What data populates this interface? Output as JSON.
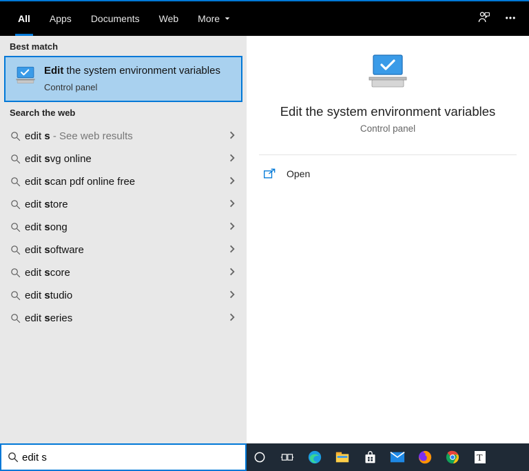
{
  "header": {
    "tabs": [
      {
        "label": "All",
        "active": true
      },
      {
        "label": "Apps"
      },
      {
        "label": "Documents"
      },
      {
        "label": "Web"
      },
      {
        "label": "More",
        "dropdown": true
      }
    ]
  },
  "left": {
    "best_label": "Best match",
    "best": {
      "title_bold": "Edit",
      "title_rest": " the system environment variables",
      "subtitle": "Control panel"
    },
    "web_label": "Search the web",
    "web_items": [
      {
        "pre": "edit ",
        "bold": "s",
        "post": "",
        "suffix": " - See web results",
        "suffix_grey": true
      },
      {
        "pre": "edit ",
        "bold": "s",
        "post": "vg online"
      },
      {
        "pre": "edit ",
        "bold": "s",
        "post": "can pdf online free"
      },
      {
        "pre": "edit ",
        "bold": "s",
        "post": "tore"
      },
      {
        "pre": "edit ",
        "bold": "s",
        "post": "ong"
      },
      {
        "pre": "edit ",
        "bold": "s",
        "post": "oftware"
      },
      {
        "pre": "edit ",
        "bold": "s",
        "post": "core"
      },
      {
        "pre": "edit ",
        "bold": "s",
        "post": "tudio"
      },
      {
        "pre": "edit ",
        "bold": "s",
        "post": "eries"
      }
    ]
  },
  "right": {
    "title": "Edit the system environment variables",
    "subtitle": "Control panel",
    "actions": [
      {
        "label": "Open"
      }
    ]
  },
  "search": {
    "value": "edit s"
  },
  "taskbar_icons": [
    "cortana-circle",
    "task-view",
    "edge",
    "file-explorer",
    "store",
    "mail",
    "firefox",
    "chrome",
    "text-cursor"
  ]
}
